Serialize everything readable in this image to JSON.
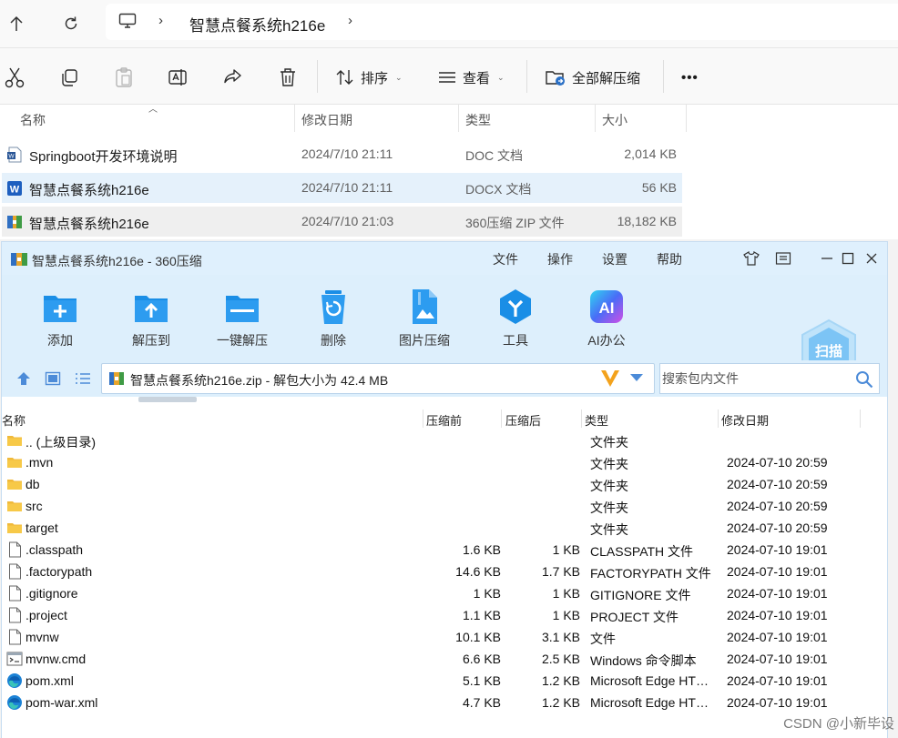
{
  "explorer": {
    "path": "智慧点餐系统h216e",
    "toolbar": {
      "cut_icon": "scissors-icon",
      "copy_icon": "copy-icon",
      "paste_icon": "paste-icon",
      "rename_icon": "rename-icon",
      "share_icon": "share-icon",
      "delete_icon": "trash-icon",
      "sort_label": "排序",
      "view_label": "查看",
      "extract_all_label": "全部解压缩",
      "more_label": "•••"
    },
    "columns": {
      "name": "名称",
      "modified": "修改日期",
      "type": "类型",
      "size": "大小"
    },
    "files": [
      {
        "name": "Springboot开发环境说明",
        "modified": "2024/7/10 21:11",
        "type": "DOC 文档",
        "size": "2,014 KB",
        "icon": "word-doc-icon"
      },
      {
        "name": "智慧点餐系统h216e",
        "modified": "2024/7/10 21:11",
        "type": "DOCX 文档",
        "size": "56 KB",
        "icon": "word-docx-icon",
        "selected": true
      },
      {
        "name": "智慧点餐系统h216e",
        "modified": "2024/7/10 21:03",
        "type": "360压缩 ZIP 文件",
        "size": "18,182 KB",
        "icon": "zip-archive-icon",
        "hovered": true
      }
    ]
  },
  "archiver": {
    "title": "智慧点餐系统h216e - 360压缩",
    "menu": [
      "文件",
      "操作",
      "设置",
      "帮助"
    ],
    "tools": [
      {
        "label": "添加",
        "icon": "add-folder-icon"
      },
      {
        "label": "解压到",
        "icon": "extract-to-icon"
      },
      {
        "label": "一键解压",
        "icon": "one-click-extract-icon"
      },
      {
        "label": "删除",
        "icon": "recycle-bin-icon"
      },
      {
        "label": "图片压缩",
        "icon": "image-compress-icon"
      },
      {
        "label": "工具",
        "icon": "tools-icon"
      },
      {
        "label": "AI办公",
        "icon": "ai-office-icon"
      }
    ],
    "scan_label": "扫描",
    "path_text": "智慧点餐系统h216e.zip - 解包大小为 42.4 MB",
    "search_placeholder": "搜索包内文件",
    "columns": {
      "name": "名称",
      "before": "压缩前",
      "after": "压缩后",
      "type": "类型",
      "modified": "修改日期"
    },
    "entries": [
      {
        "name": ".. (上级目录)",
        "before": "",
        "after": "",
        "type": "文件夹",
        "modified": "",
        "icon": "folder-icon"
      },
      {
        "name": ".mvn",
        "before": "",
        "after": "",
        "type": "文件夹",
        "modified": "2024-07-10 20:59",
        "icon": "folder-icon"
      },
      {
        "name": "db",
        "before": "",
        "after": "",
        "type": "文件夹",
        "modified": "2024-07-10 20:59",
        "icon": "folder-icon"
      },
      {
        "name": "src",
        "before": "",
        "after": "",
        "type": "文件夹",
        "modified": "2024-07-10 20:59",
        "icon": "folder-icon"
      },
      {
        "name": "target",
        "before": "",
        "after": "",
        "type": "文件夹",
        "modified": "2024-07-10 20:59",
        "icon": "folder-icon"
      },
      {
        "name": ".classpath",
        "before": "1.6 KB",
        "after": "1 KB",
        "type": "CLASSPATH 文件",
        "modified": "2024-07-10 19:01",
        "icon": "file-icon"
      },
      {
        "name": ".factorypath",
        "before": "14.6 KB",
        "after": "1.7 KB",
        "type": "FACTORYPATH 文件",
        "modified": "2024-07-10 19:01",
        "icon": "file-icon"
      },
      {
        "name": ".gitignore",
        "before": "1 KB",
        "after": "1 KB",
        "type": "GITIGNORE 文件",
        "modified": "2024-07-10 19:01",
        "icon": "file-icon"
      },
      {
        "name": ".project",
        "before": "1.1 KB",
        "after": "1 KB",
        "type": "PROJECT 文件",
        "modified": "2024-07-10 19:01",
        "icon": "file-icon"
      },
      {
        "name": "mvnw",
        "before": "10.1 KB",
        "after": "3.1 KB",
        "type": "文件",
        "modified": "2024-07-10 19:01",
        "icon": "file-icon"
      },
      {
        "name": "mvnw.cmd",
        "before": "6.6 KB",
        "after": "2.5 KB",
        "type": "Windows 命令脚本",
        "modified": "2024-07-10 19:01",
        "icon": "cmd-script-icon"
      },
      {
        "name": "pom.xml",
        "before": "5.1 KB",
        "after": "1.2 KB",
        "type": "Microsoft Edge HTML Document",
        "modified": "2024-07-10 19:01",
        "icon": "edge-icon"
      },
      {
        "name": "pom-war.xml",
        "before": "4.7 KB",
        "after": "1.2 KB",
        "type": "Microsoft Edge HTML Document",
        "modified": "2024-07-10 19:01",
        "icon": "edge-icon"
      }
    ]
  },
  "watermark": "CSDN @小新毕设",
  "colors": {
    "accent": "#1a8ee6",
    "selected_row": "#e5f1fb",
    "archiver_bg": "#ddeffc"
  }
}
